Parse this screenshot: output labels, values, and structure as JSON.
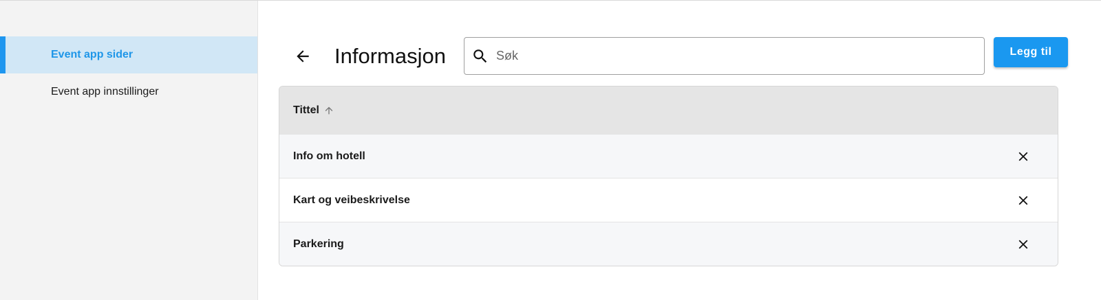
{
  "sidebar": {
    "items": [
      {
        "label": "Event app sider",
        "active": true
      },
      {
        "label": "Event app innstillinger",
        "active": false
      }
    ]
  },
  "header": {
    "title": "Informasjon",
    "back_icon": "arrow-left-icon"
  },
  "search": {
    "placeholder": "Søk",
    "value": "",
    "icon": "search-icon"
  },
  "toolbar": {
    "add_label": "Legg til"
  },
  "table": {
    "column_header": "Tittel",
    "sort_icon": "arrow-up-icon",
    "rows": [
      {
        "title": "Info om hotell"
      },
      {
        "title": "Kart og veibeskrivelse"
      },
      {
        "title": "Parkering"
      }
    ]
  },
  "colors": {
    "accent": "#1a98f0",
    "sidebar_active_bg": "#d1e7f6",
    "sidebar_bg": "#f3f3f3",
    "table_header_bg": "#e5e5e5"
  }
}
